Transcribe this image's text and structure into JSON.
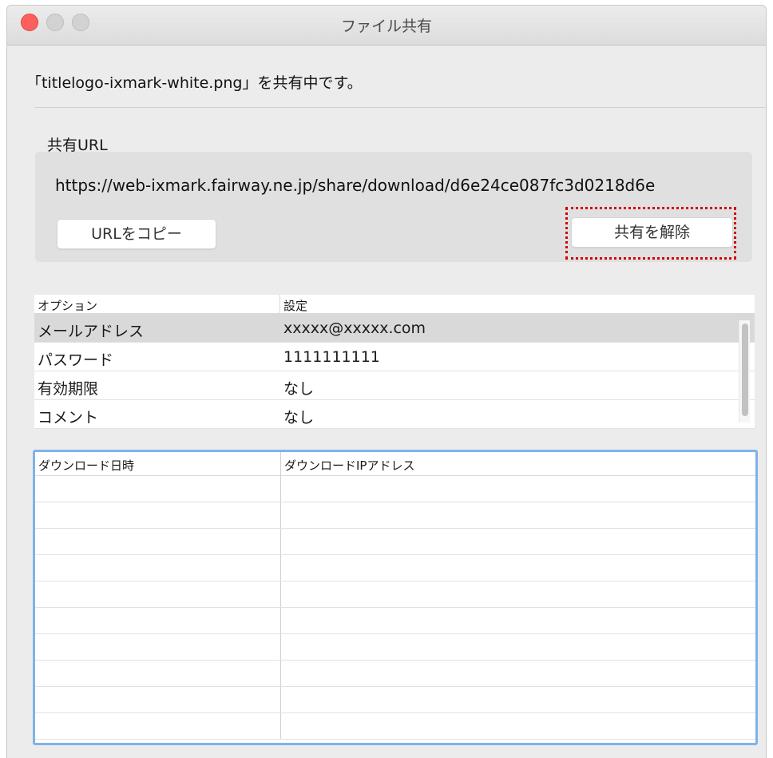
{
  "window": {
    "title": "ファイル共有"
  },
  "status": "「titlelogo-ixmark-white.png」を共有中です。",
  "share": {
    "label": "共有URL",
    "url": "https://web-ixmark.fairway.ne.jp/share/download/d6e24ce087fc3d0218d6e",
    "copy_button": "URLをコピー",
    "unshare_button": "共有を解除"
  },
  "options": {
    "headers": {
      "option": "オプション",
      "setting": "設定"
    },
    "rows": [
      {
        "option": "メールアドレス",
        "setting": "xxxxx@xxxxx.com"
      },
      {
        "option": "パスワード",
        "setting": "1111111111"
      },
      {
        "option": "有効期限",
        "setting": "なし"
      },
      {
        "option": "コメント",
        "setting": "なし"
      }
    ]
  },
  "downloads": {
    "headers": {
      "datetime": "ダウンロード日時",
      "ip": "ダウンロードIPアドレス"
    },
    "rows": []
  }
}
